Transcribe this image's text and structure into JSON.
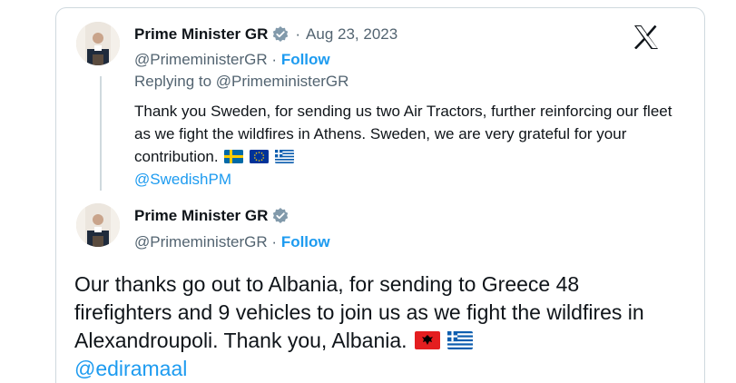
{
  "quoted_tweet": {
    "author_name": "Prime Minister GR",
    "date_separator": "·",
    "date": "Aug 23, 2023",
    "handle": "@PrimeministerGR",
    "separator": "·",
    "follow_label": "Follow",
    "replying_to": "Replying to @PrimeministerGR",
    "text": "Thank you Sweden, for sending us two Air Tractors, further reinforcing our fleet as we fight the wildfires in Athens. Sweden, we are very grateful for your contribution.",
    "flags": [
      "sweden-flag",
      "eu-flag",
      "greece-flag"
    ],
    "mention": "@SwedishPM"
  },
  "main_tweet": {
    "author_name": "Prime Minister GR",
    "handle": "@PrimeministerGR",
    "separator": "·",
    "follow_label": "Follow",
    "text": "Our thanks go out to Albania, for sending to Greece 48 firefighters and 9 vehicles to join us as we fight the wildfires in Alexandroupoli. Thank you, Albania.",
    "flags": [
      "albania-flag",
      "greece-flag"
    ],
    "mention": "@ediramaal"
  },
  "icons": {
    "verified": "verified-badge-icon",
    "brand": "x-logo-icon"
  },
  "colors": {
    "accent": "#1d9bf0",
    "text_primary": "#0f1419",
    "text_secondary": "#536471",
    "border": "#cfd9de"
  }
}
